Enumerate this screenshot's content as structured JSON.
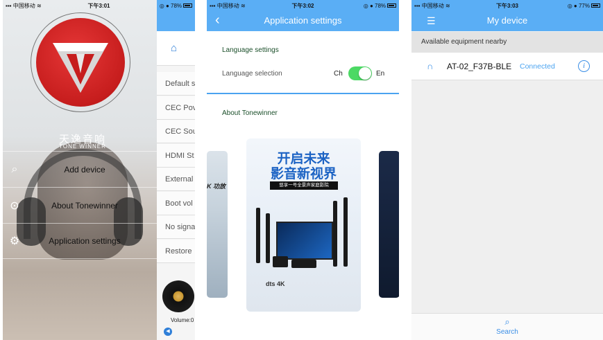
{
  "accent": "#5aaef5",
  "panel1": {
    "status": {
      "carrier": "中国移动",
      "time": "下午3:01",
      "battery": "78%"
    },
    "brand_cn": "天逸音响",
    "brand_en": "TONE WINNER",
    "menu": [
      {
        "label": "Add device",
        "icon": "search-icon"
      },
      {
        "label": "About Tonewinner",
        "icon": "arrow-circle-icon"
      },
      {
        "label": "Application settings",
        "icon": "gear-icon"
      }
    ],
    "behind_items": [
      "Default s",
      "CEC Pov",
      "CEC Sou",
      "HDMI St",
      "External",
      "Boot vol",
      "No signa",
      "Restore"
    ],
    "volume_label": "Volume:0"
  },
  "panel2": {
    "status": {
      "carrier": "中国移动",
      "time": "下午3:02",
      "battery": "78%"
    },
    "title": "Application settings",
    "language_settings": "Language settings",
    "language_selection": "Language selection",
    "ch": "Ch",
    "en": "En",
    "toggle_on": true,
    "about": "About Tonewinner",
    "promo_line1": "开启未来",
    "promo_line2": "影音新视界",
    "promo_tag": "悠享一号全景声家庭影院",
    "promo_logos": "dts 4K",
    "left_card_text": "K 功放"
  },
  "panel3": {
    "status": {
      "carrier": "中国移动",
      "time": "下午3:03",
      "battery": "77%"
    },
    "title": "My device",
    "available": "Available equipment nearby",
    "device_name": "AT-02_F37B-BLE",
    "device_status": "Connected",
    "search_label": "Search"
  }
}
